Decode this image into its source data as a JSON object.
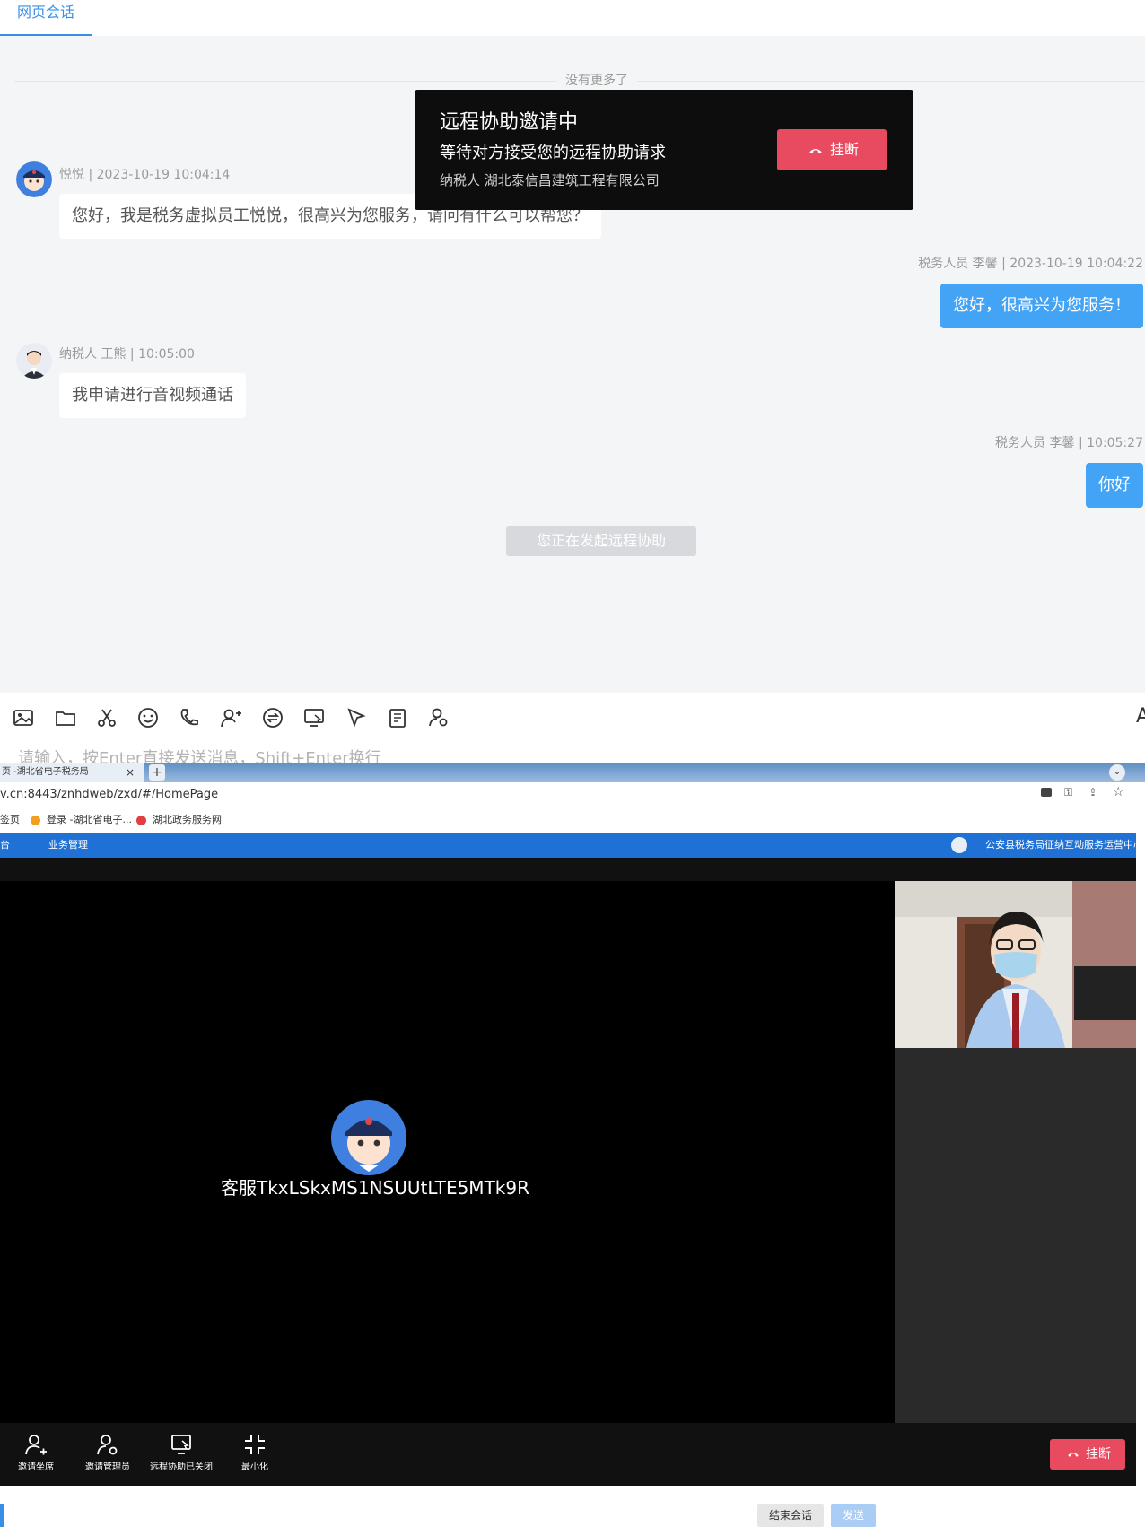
{
  "chat": {
    "tab_label": "网页会话",
    "no_more": "没有更多了",
    "messages": [
      {
        "meta": "悦悦 | 2023-10-19 10:04:14",
        "text": "您好，我是税务虚拟员工悦悦，很高兴为您服务，请问有什么可以帮您？"
      },
      {
        "meta": "税务人员 李馨 | 2023-10-19 10:04:22",
        "text": "您好，很高兴为您服务！"
      },
      {
        "meta": "纳税人 王熊 | 10:05:00",
        "text": "我申请进行音视频通话"
      },
      {
        "meta": "税务人员 李馨 | 10:05:27",
        "text": "你好"
      }
    ],
    "system_note": "您正在发起远程协助"
  },
  "popup": {
    "title": "远程协助邀请中",
    "subtitle": "等待对方接受您的远程协助请求",
    "company": "纳税人 湖北泰信昌建筑工程有限公司",
    "hangup_label": "挂断"
  },
  "input": {
    "placeholder": "请输入，按Enter直接发送消息，Shift+Enter换行",
    "end_session": "结束会话",
    "send": "发送"
  },
  "browser": {
    "tab_title": "页 -湖北省电子税务局",
    "url": "v.cn:8443/znhdweb/zxd/#/HomePage",
    "bookmarks": [
      "签页",
      "登录 -湖北省电子...",
      "湖北政务服务网"
    ],
    "nav_items": [
      "台",
      "业务管理"
    ],
    "nav_right": "公安县税务局征纳互动服务运营中心"
  },
  "video": {
    "caller_name": "客服TkxLSkxMS1NSUUtLTE5MTk9R",
    "controls": [
      "邀请坐席",
      "邀请管理员",
      "远程协助已关闭",
      "最小化"
    ],
    "hangup_label": "挂断"
  },
  "colors": {
    "accent": "#3a8ee6",
    "bubble_out": "#43a3f5",
    "danger": "#e84a5f"
  }
}
